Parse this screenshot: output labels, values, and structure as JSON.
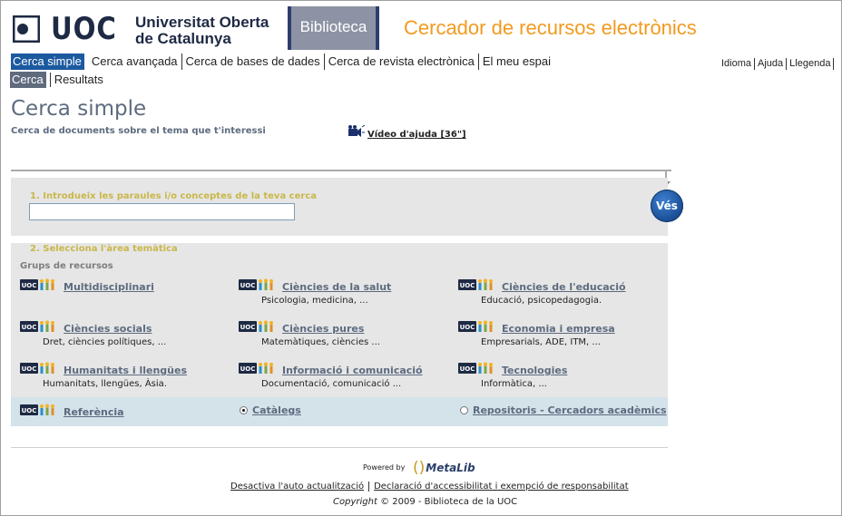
{
  "brand": {
    "uoc_letters": "UOC",
    "university_line1": "Universitat Oberta",
    "university_line2": "de Catalunya",
    "library_label": "Biblioteca",
    "app_title": "Cercador de recursos electrònics",
    "accent_color": "#f39a1e",
    "navy_color": "#1e2a44"
  },
  "nav": {
    "items": [
      {
        "label": "Cerca simple",
        "active": true
      },
      {
        "label": "Cerca avançada",
        "active": false
      },
      {
        "label": "Cerca de bases de dades",
        "active": false
      },
      {
        "label": "Cerca de revista electrònica",
        "active": false
      },
      {
        "label": "El meu espai",
        "active": false
      }
    ],
    "sub_items": [
      {
        "label": "Cerca",
        "active": true
      },
      {
        "label": "Resultats",
        "active": false
      }
    ],
    "utility": [
      {
        "label": "Idioma"
      },
      {
        "label": "Ajuda"
      },
      {
        "label": "Llegenda"
      }
    ]
  },
  "page": {
    "title": "Cerca simple",
    "subtitle": "Cerca de documents sobre el tema que t'interessi",
    "video_icon": "video-camera-icon",
    "video_link": "Vídeo d'ajuda [36\"]"
  },
  "search": {
    "step1_label": "1. Introdueix les paraules i/o conceptes de la teva cerca",
    "query_value": "",
    "go_label": "Vés",
    "step2_label": "2. Selecciona l'àrea temàtica",
    "groups_label": "Grups de recursos"
  },
  "resources": [
    {
      "name": "Multidisciplinari",
      "desc": ""
    },
    {
      "name": "Ciències de la salut",
      "desc": "Psicologia, medicina, ..."
    },
    {
      "name": "Ciències de l'educació",
      "desc": "Educació, psicopedagogia."
    },
    {
      "name": "Ciències socials",
      "desc": "Dret, ciències polítiques, ..."
    },
    {
      "name": "Ciències pures",
      "desc": "Matemàtiques, ciències ..."
    },
    {
      "name": "Economia i empresa",
      "desc": "Empresarials, ADE, ITM, ..."
    },
    {
      "name": "Humanitats i llengües",
      "desc": "Humanitats, llengües, Àsia."
    },
    {
      "name": "Informació i comunicació",
      "desc": "Documentació, comunicació ..."
    },
    {
      "name": "Tecnologies",
      "desc": "Informàtica, ..."
    }
  ],
  "bottom_row": {
    "referencia": "Referència",
    "catalegs": "Catàlegs",
    "catalegs_selected": true,
    "repositoris": "Repositoris - Cercadors acadèmics",
    "repositoris_selected": false
  },
  "footer": {
    "powered_by": "Powered by",
    "metalib": "MetaLib",
    "links": [
      "Desactiva l'auto actualització",
      "Declaració d'accessibilitat i exempció de responsabilitat"
    ],
    "copyright_word": "Copyright",
    "copyright_rest": "© 2009 - Biblioteca de la UOC"
  }
}
